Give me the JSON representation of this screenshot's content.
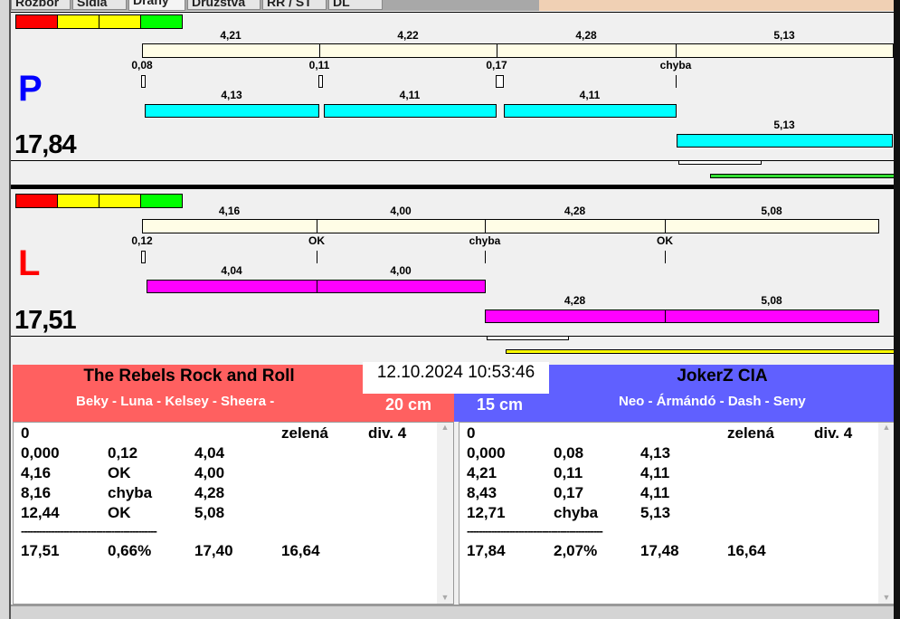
{
  "tabs": [
    "Rozbor",
    "Sidla",
    "Dráhy",
    "Družstva",
    "RR / ST",
    "DL"
  ],
  "colors": {
    "red": "#ff0000",
    "yellow": "#ffff00",
    "green": "#00ff00",
    "cream": "#fffde6",
    "cyan": "#00ffff",
    "magenta": "#ff00ff",
    "left_team": "#ff6060",
    "right_team": "#6060ff"
  },
  "lanes": [
    {
      "letter": "P",
      "letter_color": "#0000ff",
      "score": "17,84",
      "bar_color": "#00ffff",
      "bottom_color": "#33dd33",
      "times": [
        "4,21",
        "4,22",
        "4,28",
        "5,13"
      ],
      "reactions": [
        "0,08",
        "0,11",
        "0,17",
        "chyba"
      ],
      "row1": [
        "4,13",
        "4,11",
        "4,11"
      ],
      "row2": [
        "5,13"
      ]
    },
    {
      "letter": "L",
      "letter_color": "#ff0000",
      "score": "17,51",
      "bar_color": "#ff00ff",
      "bottom_color": "#ffff00",
      "times": [
        "4,16",
        "4,00",
        "4,28",
        "5,08"
      ],
      "reactions": [
        "0,12",
        "OK",
        "chyba",
        "OK"
      ],
      "row1": [
        "4,04",
        "4,00"
      ],
      "row2": [
        "4,28",
        "5,08"
      ]
    }
  ],
  "datetime": "12.10.2024 10:53:46",
  "left_team": {
    "name": "The Rebels Rock and Roll",
    "players": "Beky - Luna - Kelsey - Sheera -",
    "distance": "20 cm",
    "rows": [
      [
        "0",
        "",
        "",
        "zelená",
        "div. 4"
      ],
      [
        "0,000",
        "0,12",
        "4,04"
      ],
      [
        "4,16",
        "OK",
        "4,00"
      ],
      [
        "8,16",
        "chyba",
        "4,28"
      ],
      [
        "12,44",
        "OK",
        "5,08"
      ],
      [
        "---------------------------------------------"
      ],
      [
        "17,51",
        "0,66%",
        "17,40",
        "16,64"
      ]
    ]
  },
  "right_team": {
    "name": "JokerZ CIA",
    "players": "Neo - Ármándó - Dash - Seny",
    "distance": "15 cm",
    "rows": [
      [
        "0",
        "",
        "",
        "zelená",
        "div. 4"
      ],
      [
        "0,000",
        "0,08",
        "4,13"
      ],
      [
        "4,21",
        "0,11",
        "4,11"
      ],
      [
        "8,43",
        "0,17",
        "4,11"
      ],
      [
        "12,71",
        "chyba",
        "5,13"
      ],
      [
        "---------------------------------------------"
      ],
      [
        "17,84",
        "2,07%",
        "17,48",
        "16,64"
      ]
    ]
  }
}
